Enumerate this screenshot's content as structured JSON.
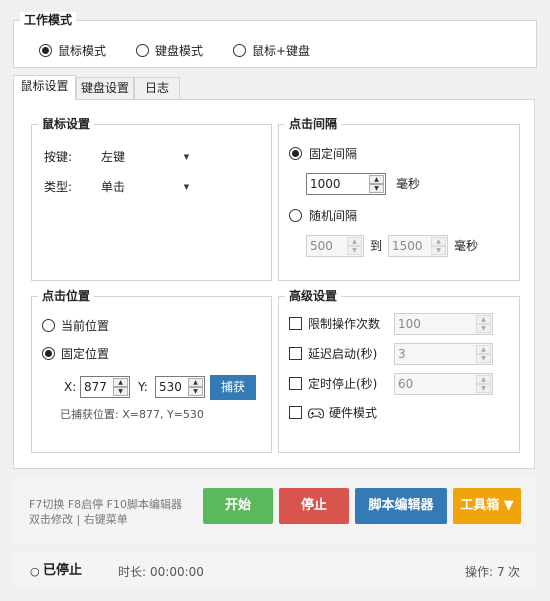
{
  "mode": {
    "title": "工作模式",
    "options": [
      {
        "label": "鼠标模式",
        "selected": true
      },
      {
        "label": "键盘模式",
        "selected": false
      },
      {
        "label": "鼠标+键盘",
        "selected": false
      }
    ]
  },
  "tabs": [
    "鼠标设置",
    "键盘设置",
    "日志"
  ],
  "mouse_settings": {
    "title": "鼠标设置",
    "button_label": "按键:",
    "button_value": "左键",
    "type_label": "类型:",
    "type_value": "单击"
  },
  "interval": {
    "title": "点击间隔",
    "fixed_label": "固定间隔",
    "fixed_selected": true,
    "fixed_value": "1000",
    "fixed_unit": "毫秒",
    "random_label": "随机间隔",
    "random_selected": false,
    "random_min": "500",
    "to_label": "到",
    "random_max": "1500",
    "random_unit": "毫秒"
  },
  "position": {
    "title": "点击位置",
    "current_label": "当前位置",
    "current_selected": false,
    "fixed_label": "固定位置",
    "fixed_selected": true,
    "x_label": "X:",
    "x_value": "877",
    "y_label": "Y:",
    "y_value": "530",
    "capture_button": "捕获",
    "captured_text": "已捕获位置: X=877, Y=530"
  },
  "advanced": {
    "title": "高级设置",
    "limit_label": "限制操作次数",
    "limit_value": "100",
    "delay_label": "延迟启动(秒)",
    "delay_value": "3",
    "timer_label": "定时停止(秒)",
    "timer_value": "60",
    "hardware_label": "硬件模式",
    "hardware_icon": "gamepad-icon"
  },
  "hints": {
    "line1": "F7切换 F8启停 F10脚本编辑器",
    "line2": "双击修改 | 右键菜单"
  },
  "buttons": {
    "start": "开始",
    "stop": "停止",
    "script_editor": "脚本编辑器",
    "toolbox": "工具箱 ▼"
  },
  "colors": {
    "start": "#5cb85c",
    "stop": "#d9534f",
    "script_editor": "#337ab7",
    "toolbox": "#f0a30a",
    "capture": "#337ab7"
  },
  "status": {
    "state": "已停止",
    "duration_label": "时长:",
    "duration_value": "00:00:00",
    "ops_label": "操作:",
    "ops_count": "7",
    "ops_unit": "次"
  }
}
